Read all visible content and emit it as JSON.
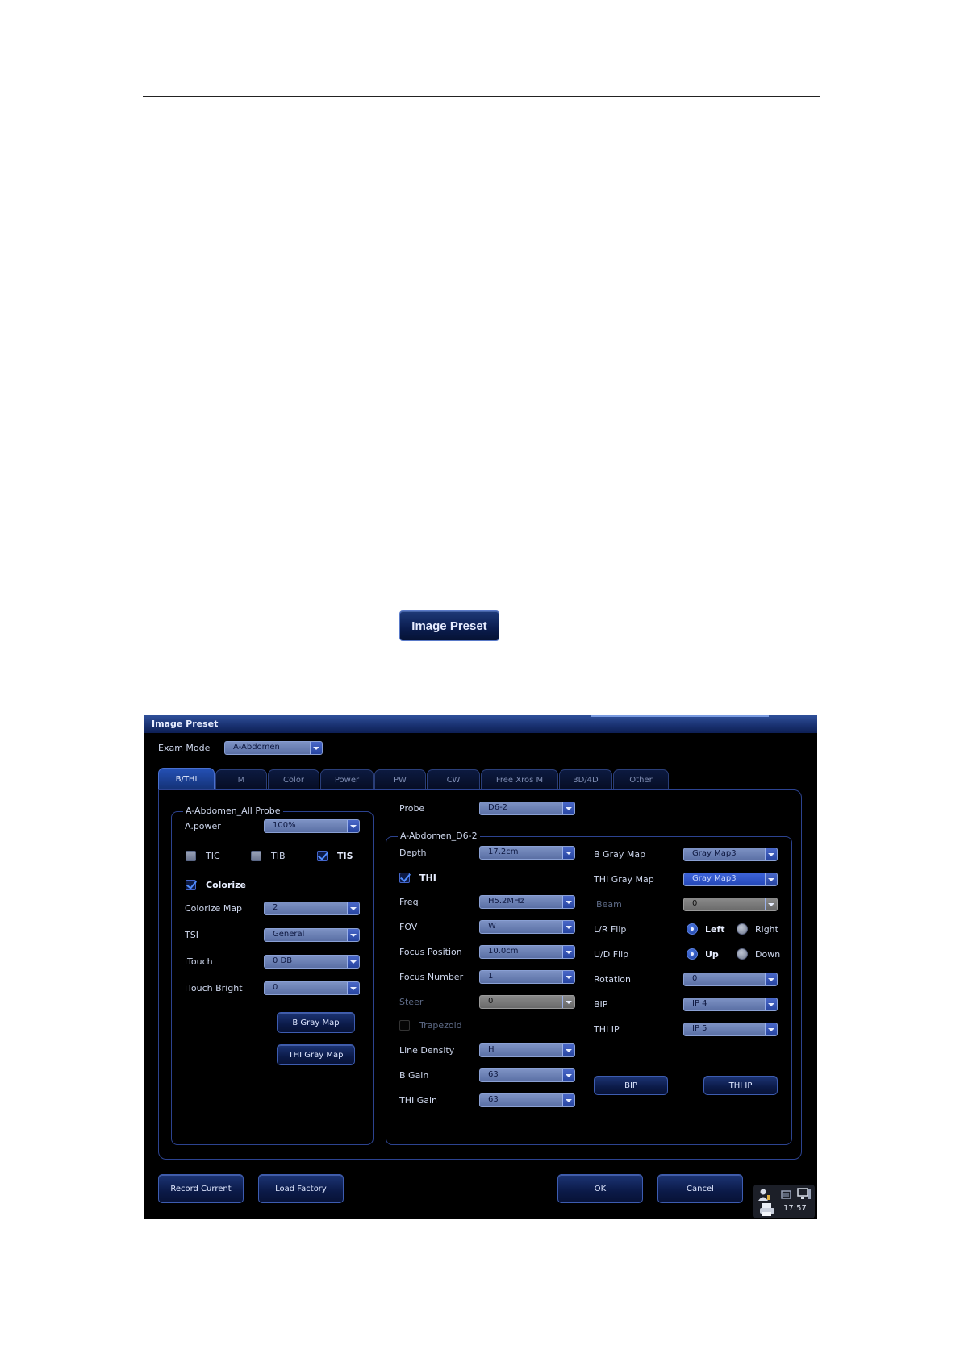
{
  "hero_button": "Image Preset",
  "dialog": {
    "title": "Image Preset",
    "exam_mode": {
      "label": "Exam Mode",
      "value": "A-Abdomen"
    },
    "tabs": [
      "B/THI",
      "M",
      "Color",
      "Power",
      "PW",
      "CW",
      "Free Xros M",
      "3D/4D",
      "Other"
    ],
    "active_tab": "B/THI",
    "left_group": {
      "legend": "A-Abdomen_All Probe",
      "apower": {
        "label": "A.power",
        "value": "100%"
      },
      "tic": "TIC",
      "tib": "TIB",
      "tis": "TIS",
      "tis_checked": true,
      "colorize": {
        "label": "Colorize",
        "checked": true
      },
      "colorize_map": {
        "label": "Colorize Map",
        "value": "2"
      },
      "tsi": {
        "label": "TSI",
        "value": "General"
      },
      "itouch": {
        "label": "iTouch",
        "value": "0 DB"
      },
      "itouch_bright": {
        "label": "iTouch Bright",
        "value": "0"
      },
      "b_gray_map_btn": "B Gray Map",
      "thi_gray_map_btn": "THI Gray Map"
    },
    "probe": {
      "label": "Probe",
      "value": "D6-2"
    },
    "right_group": {
      "legend": "A-Abdomen_D6-2",
      "depth": {
        "label": "Depth",
        "value": "17.2cm"
      },
      "thi": {
        "label": "THI",
        "checked": true
      },
      "freq": {
        "label": "Freq",
        "value": "H5.2MHz"
      },
      "fov": {
        "label": "FOV",
        "value": "W"
      },
      "focus_position": {
        "label": "Focus Position",
        "value": "10.0cm"
      },
      "focus_number": {
        "label": "Focus Number",
        "value": "1"
      },
      "steer": {
        "label": "Steer",
        "value": "0"
      },
      "trapezoid": {
        "label": "Trapezoid",
        "checked": false
      },
      "line_density": {
        "label": "Line Density",
        "value": "H"
      },
      "b_gain": {
        "label": "B Gain",
        "value": "63"
      },
      "thi_gain": {
        "label": "THI Gain",
        "value": "63"
      },
      "b_gray_map": {
        "label": "B Gray Map",
        "value": "Gray Map3"
      },
      "thi_gray_map": {
        "label": "THI Gray Map",
        "value": "Gray Map3"
      },
      "ibeam": {
        "label": "iBeam",
        "value": "0"
      },
      "lr_flip": {
        "label": "L/R Flip",
        "left": "Left",
        "right": "Right",
        "selected": "Left"
      },
      "ud_flip": {
        "label": "U/D Flip",
        "up": "Up",
        "down": "Down",
        "selected": "Up"
      },
      "rotation": {
        "label": "Rotation",
        "value": "0"
      },
      "bip": {
        "label": "BIP",
        "value": "IP 4"
      },
      "thi_ip": {
        "label": "THI IP",
        "value": "IP 5"
      },
      "bip_btn": "BIP",
      "thi_ip_btn": "THI IP"
    },
    "footer": {
      "record_current": "Record Current",
      "load_factory": "Load Factory",
      "ok": "OK",
      "cancel": "Cancel"
    },
    "tray": {
      "time": "17:57",
      "icons": [
        "user-icon",
        "printer-icon",
        "network-icon",
        "monitor-icon"
      ]
    },
    "colors": {
      "accent": "#2450b4",
      "background": "#000000",
      "border": "#2c4390"
    }
  }
}
